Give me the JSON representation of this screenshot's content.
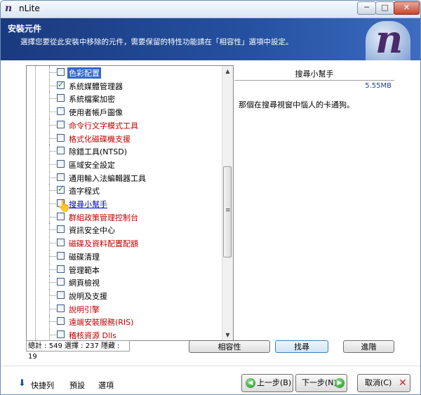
{
  "window": {
    "title": "nLite",
    "app_icon": "n"
  },
  "titlebar_buttons": {
    "minimize": "─",
    "maximize": "□",
    "close": "✕"
  },
  "header": {
    "title": "安裝元件",
    "subtitle": "選擇您要從此安裝中移除的元件，需要保留的特性功能請在「相容性」選項中設定。",
    "logo_letter": "n"
  },
  "tree": {
    "items": [
      {
        "label": "色彩配置",
        "checked": false,
        "style": "selected"
      },
      {
        "label": "系統媒體管理器",
        "checked": true,
        "style": "normal"
      },
      {
        "label": "系統檔案加密",
        "checked": false,
        "style": "normal"
      },
      {
        "label": "使用者帳戶圖像",
        "checked": false,
        "style": "normal"
      },
      {
        "label": "命令行文字模式工具",
        "checked": false,
        "style": "red"
      },
      {
        "label": "格式化磁碟機支援",
        "checked": false,
        "style": "red"
      },
      {
        "label": "除錯工具(NTSD)",
        "checked": false,
        "style": "normal"
      },
      {
        "label": "區域安全設定",
        "checked": false,
        "style": "normal"
      },
      {
        "label": "通用輸入法編輯器工具",
        "checked": false,
        "style": "normal"
      },
      {
        "label": "造字程式",
        "checked": true,
        "style": "normal"
      },
      {
        "label": "搜尋小幫手",
        "checked": false,
        "style": "link"
      },
      {
        "label": "群組政策管理控制台",
        "checked": false,
        "style": "red"
      },
      {
        "label": "資訊安全中心",
        "checked": false,
        "style": "normal"
      },
      {
        "label": "磁碟及資料配置配額",
        "checked": false,
        "style": "red"
      },
      {
        "label": "磁碟清理",
        "checked": false,
        "style": "normal"
      },
      {
        "label": "管理範本",
        "checked": false,
        "style": "normal"
      },
      {
        "label": "網頁檢視",
        "checked": false,
        "style": "normal"
      },
      {
        "label": "說明及支援",
        "checked": false,
        "style": "normal"
      },
      {
        "label": "說明引擎",
        "checked": false,
        "style": "red"
      },
      {
        "label": "遠端安裝服務(RIS)",
        "checked": false,
        "style": "red"
      },
      {
        "label": "稽核資源 Dlls",
        "checked": false,
        "style": "red"
      }
    ],
    "scroll_up": "▲",
    "scroll_down": "▼",
    "scroll_grip": "≡"
  },
  "status": {
    "text": "總計 : 549 選擇 : 237 隱藏 : 19"
  },
  "description": {
    "title": "搜尋小幫手",
    "size": "5.55MB",
    "body": "那個在搜尋視窗中惱人的卡通狗。"
  },
  "buttons": {
    "compat": "相容性",
    "find": "找尋",
    "advanced": "進階"
  },
  "footer": {
    "shortcut": "快捷列",
    "preset": "預設",
    "options": "選項",
    "back": "上一步(B)",
    "next": "下一步(N)",
    "cancel": "取消(C)"
  }
}
